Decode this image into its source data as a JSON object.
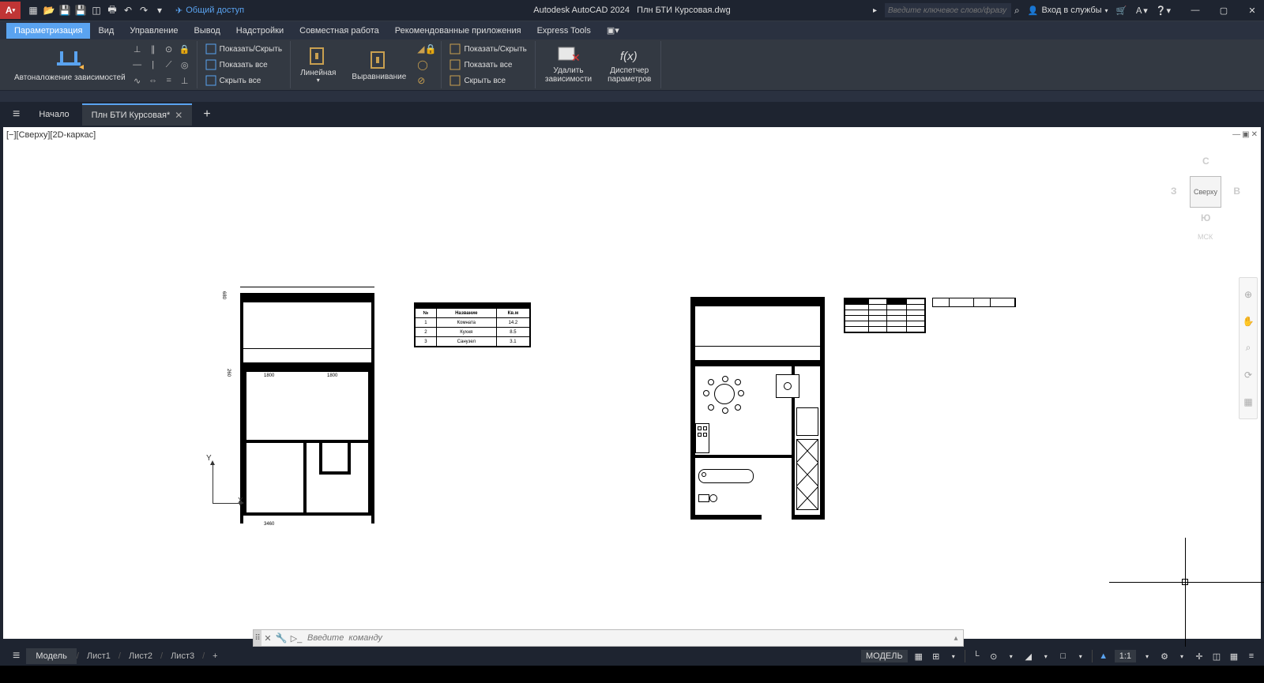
{
  "title": {
    "app": "Autodesk AutoCAD 2024",
    "file": "Плн БТИ Курсовая.dwg"
  },
  "share_label": "Общий доступ",
  "search_placeholder": "Введите ключевое слово/фразу",
  "signin_label": "Вход в службы",
  "menu_tabs": [
    "Параметризация",
    "Вид",
    "Управление",
    "Вывод",
    "Надстройки",
    "Совместная работа",
    "Рекомендованные приложения",
    "Express Tools"
  ],
  "ribbon": {
    "auto_constrain": "Автоналожение зависимостей",
    "show_hide_1": "Показать/Скрыть",
    "show_all_1": "Показать все",
    "hide_all_1": "Скрыть все",
    "linear": "Линейная",
    "align": "Выравнивание",
    "show_hide_2": "Показать/Скрыть",
    "show_all_2": "Показать все",
    "hide_all_2": "Скрыть все",
    "delete_constraints": "Удалить\nзависимости",
    "param_manager": "Диспетчер\nпараметров"
  },
  "file_tabs": {
    "start": "Начало",
    "file1": "Плн БТИ Курсовая*"
  },
  "view_label": "[−][Сверху][2D-каркас]",
  "viewcube": {
    "face": "Сверху",
    "n": "С",
    "s": "Ю",
    "w": "З",
    "e": "В",
    "wcs": "МСК"
  },
  "ucs": {
    "y": "Y",
    "x": "X"
  },
  "cmd_placeholder": "Введите  команду",
  "layout": {
    "model": "Модель",
    "l1": "Лист1",
    "l2": "Лист2",
    "l3": "Лист3"
  },
  "status": {
    "model": "МОДЕЛЬ",
    "scale": "1:1"
  },
  "schedule1": {
    "headers": [
      "№",
      "Название",
      "Кв.м"
    ],
    "rows": [
      [
        "1",
        "Комната",
        "14.2"
      ],
      [
        "2",
        "Кухня",
        "8.5"
      ],
      [
        "3",
        "Санузел",
        "3.1"
      ]
    ]
  }
}
